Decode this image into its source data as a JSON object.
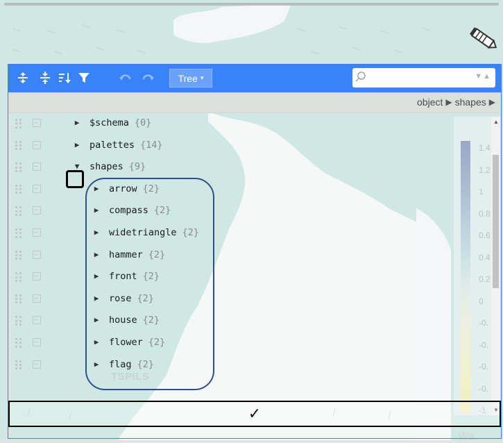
{
  "toolbar": {
    "expand_all_icon": "expand-all-icon",
    "collapse_all_icon": "collapse-all-icon",
    "sort_icon": "sort-icon",
    "filter_icon": "filter-icon",
    "undo_icon": "undo-icon",
    "redo_icon": "redo-icon",
    "mode_label": "Tree",
    "mode_caret": "▾",
    "accent_color": "#3883fa"
  },
  "search": {
    "value": "",
    "placeholder": "",
    "nav": "▼▲"
  },
  "breadcrumb": [
    "object",
    "shapes"
  ],
  "tree": {
    "rows": [
      {
        "key": "$schema",
        "count": "{0}",
        "expanded": false
      },
      {
        "key": "palettes",
        "count": "{14}",
        "expanded": false
      },
      {
        "key": "shapes",
        "count": "{9}",
        "expanded": true
      },
      {
        "key": "arrow",
        "count": "{2}",
        "expanded": false
      },
      {
        "key": "compass",
        "count": "{2}",
        "expanded": false
      },
      {
        "key": "widetriangle",
        "count": "{2}",
        "expanded": false
      },
      {
        "key": "hammer",
        "count": "{2}",
        "expanded": false
      },
      {
        "key": "front",
        "count": "{2}",
        "expanded": false
      },
      {
        "key": "rose",
        "count": "{2}",
        "expanded": false
      },
      {
        "key": "house",
        "count": "{2}",
        "expanded": false
      },
      {
        "key": "flower",
        "count": "{2}",
        "expanded": false
      },
      {
        "key": "flag",
        "count": "{2}",
        "expanded": false
      }
    ]
  },
  "scale_ticks": [
    "1.4",
    "1.2",
    "1",
    "0.8",
    "0.6",
    "0.4",
    "0.2",
    "0",
    "-0.",
    "-0.",
    "-0.",
    "-0.",
    "-1"
  ],
  "map": {
    "label": "TSPILS",
    "corner_label": "Wa"
  },
  "confirm": {
    "label": "✓"
  }
}
